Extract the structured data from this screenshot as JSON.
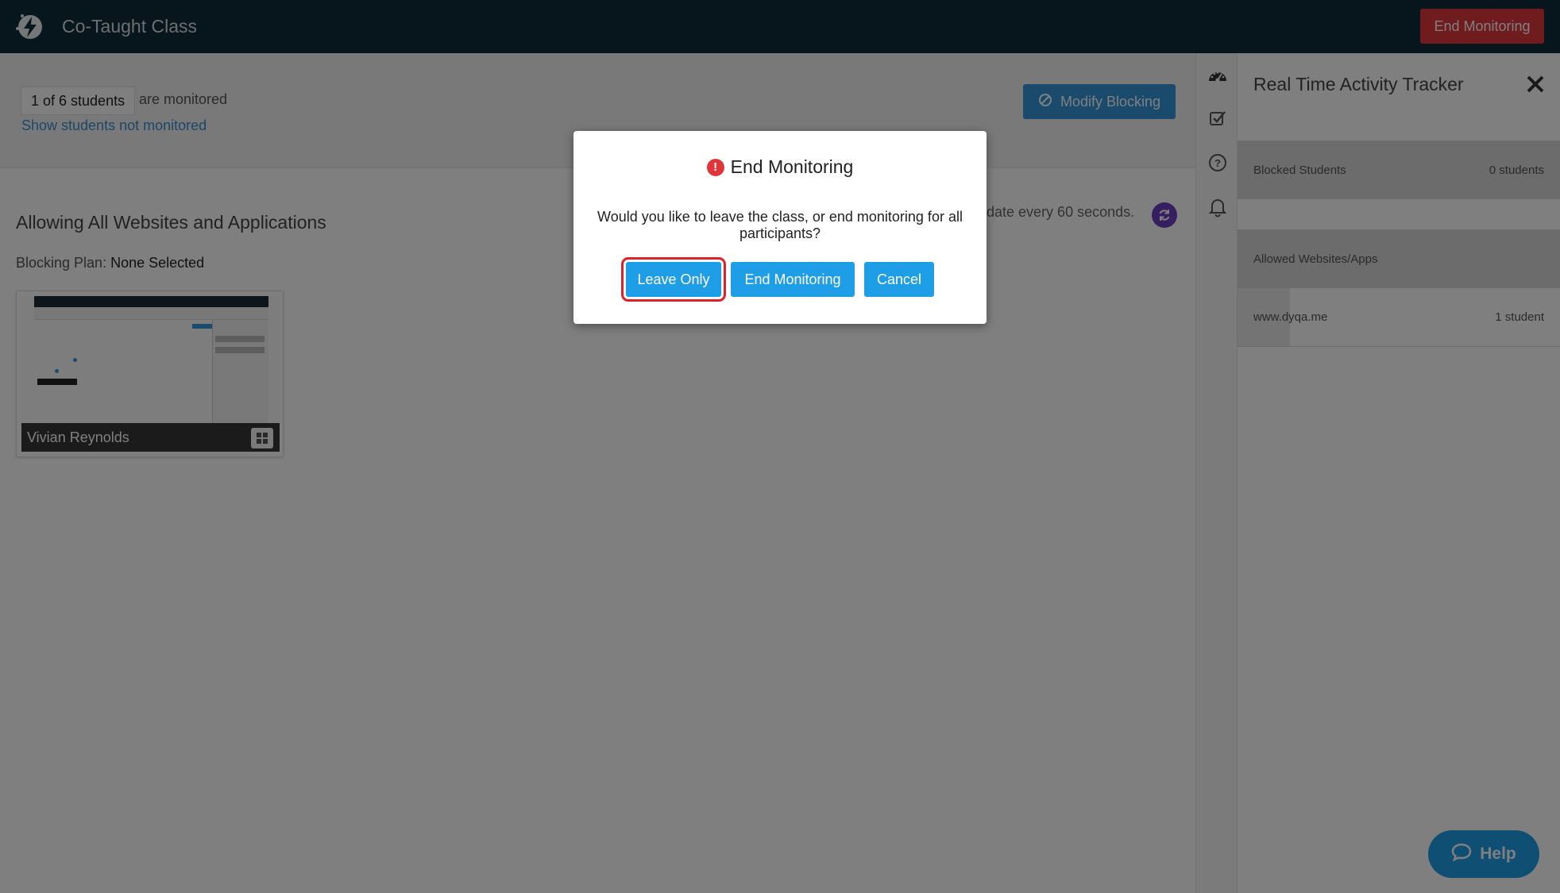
{
  "header": {
    "app_title": "Co-Taught Class",
    "end_monitoring_label": "End Monitoring"
  },
  "subbar": {
    "count_badge": "1 of 6 students",
    "monitored_suffix": "are monitored",
    "show_link": "Show students not monitored",
    "modify_blocking_label": "Modify Blocking"
  },
  "main": {
    "allow_title": "Allowing All Websites and Applications",
    "plan_label": "Blocking Plan:",
    "plan_value": "None Selected",
    "update_text": "pdate every 60 seconds.",
    "students": [
      {
        "name": "Vivian Reynolds",
        "os_icon": "windows-icon"
      }
    ]
  },
  "panel": {
    "title": "Real Time Activity Tracker",
    "blocked_label": "Blocked Students",
    "blocked_count": "0 students",
    "allowed_label": "Allowed Websites/Apps",
    "sites": [
      {
        "domain": "www.dyqa.me",
        "count": "1 student"
      }
    ]
  },
  "help": {
    "label": "Help"
  },
  "modal": {
    "title": "End Monitoring",
    "message": "Would you like to leave the class, or end monitoring for all participants?",
    "leave_label": "Leave Only",
    "end_label": "End Monitoring",
    "cancel_label": "Cancel"
  },
  "colors": {
    "header_bg": "#0f2a3b",
    "danger": "#e0363a",
    "primary": "#1f9ee8",
    "refresh_purple": "#6c3ec1"
  }
}
